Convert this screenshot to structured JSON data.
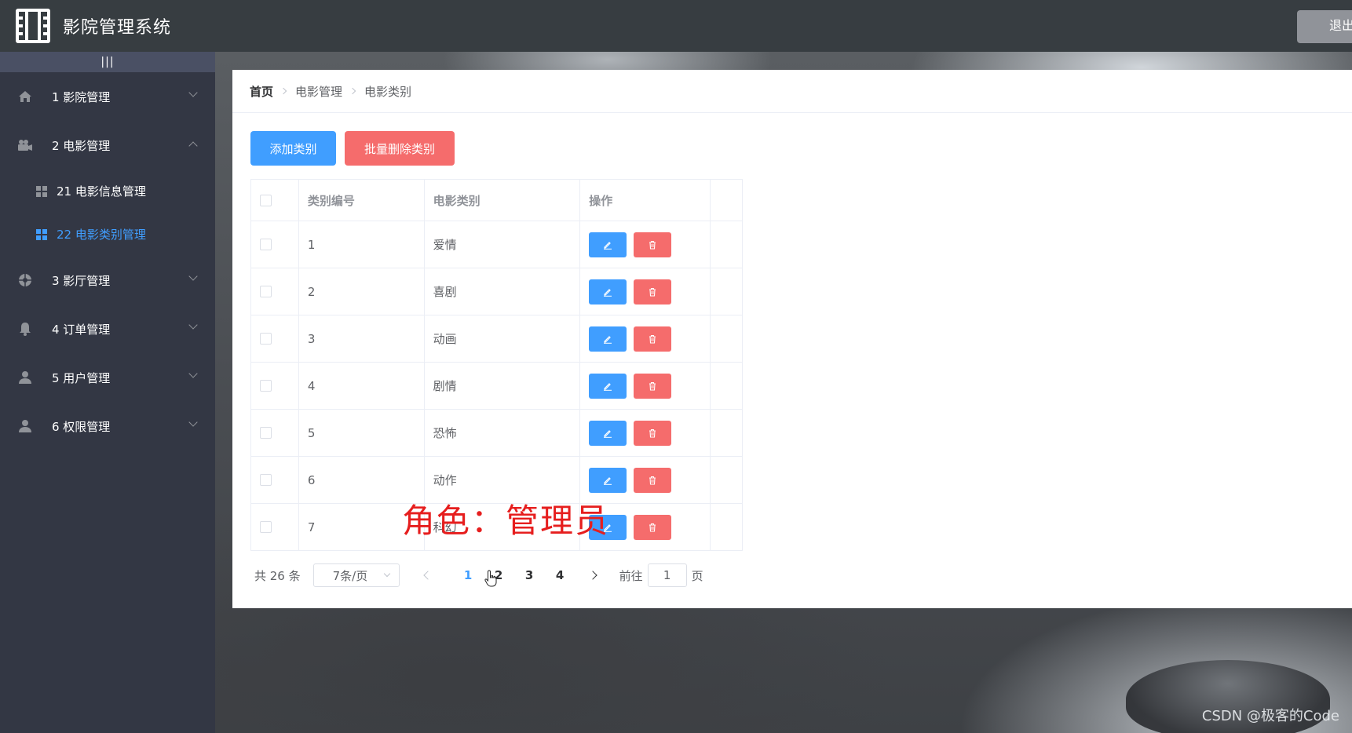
{
  "header": {
    "title": "影院管理系统",
    "logout_label": "退出"
  },
  "sidebar": {
    "toggle_label": "|||",
    "items": [
      {
        "label": "1 影院管理",
        "icon": "home-icon",
        "expanded": false
      },
      {
        "label": "2 电影管理",
        "icon": "camera-icon",
        "expanded": true,
        "children": [
          {
            "label": "21 电影信息管理",
            "active": false
          },
          {
            "label": "22 电影类别管理",
            "active": true
          }
        ]
      },
      {
        "label": "3 影厅管理",
        "icon": "aperture-icon",
        "expanded": false
      },
      {
        "label": "4 订单管理",
        "icon": "bell-icon",
        "expanded": false
      },
      {
        "label": "5 用户管理",
        "icon": "user-icon",
        "expanded": false
      },
      {
        "label": "6 权限管理",
        "icon": "user-icon",
        "expanded": false
      }
    ]
  },
  "breadcrumb": [
    "首页",
    "电影管理",
    "电影类别"
  ],
  "toolbar": {
    "add_label": "添加类别",
    "batch_delete_label": "批量删除类别"
  },
  "table": {
    "headers": [
      "类别编号",
      "电影类别",
      "操作"
    ],
    "rows": [
      {
        "id": "1",
        "name": "爱情"
      },
      {
        "id": "2",
        "name": "喜剧"
      },
      {
        "id": "3",
        "name": "动画"
      },
      {
        "id": "4",
        "name": "剧情"
      },
      {
        "id": "5",
        "name": "恐怖"
      },
      {
        "id": "6",
        "name": "动作"
      },
      {
        "id": "7",
        "name": "科幻"
      }
    ]
  },
  "overlay": {
    "role_text": "角色：管理员"
  },
  "pagination": {
    "total_text": "共 26 条",
    "page_size_text": "7条/页",
    "pages": [
      "1",
      "2",
      "3",
      "4"
    ],
    "current_page": "1",
    "goto_label": "前往",
    "goto_value": "1",
    "page_suffix": "页"
  },
  "watermark": "CSDN @极客的Code",
  "colors": {
    "header_bg": "#373d41",
    "sidebar_bg": "#333744",
    "primary": "#409eff",
    "danger": "#f56c6c",
    "role_text": "#e61e1e"
  }
}
